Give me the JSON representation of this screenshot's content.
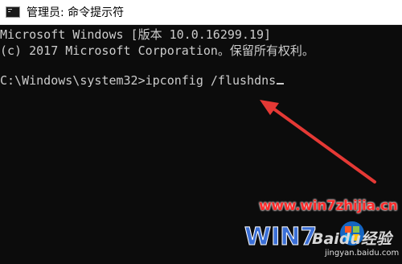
{
  "window": {
    "title": "管理员: 命令提示符",
    "icon": "console-icon"
  },
  "console": {
    "lines": [
      "Microsoft Windows [版本 10.0.16299.19]",
      "(c) 2017 Microsoft Corporation。保留所有权利。",
      "",
      "C:\\Windows\\system32>ipconfig /flushdns"
    ]
  },
  "annotation": {
    "arrow_color": "#e53935"
  },
  "watermark": {
    "url": "www.win7zhijia.cn",
    "logo_text": "WIN7",
    "baidu": "Baidu经验",
    "sub": "jingyan.baidu.com"
  },
  "colors": {
    "background": "#0c0c0c",
    "text": "#cccccc",
    "titlebar": "#ffffff"
  }
}
